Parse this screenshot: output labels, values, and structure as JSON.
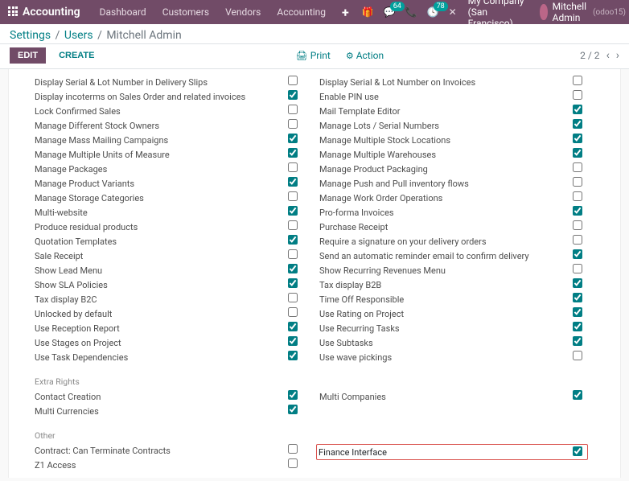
{
  "topbar": {
    "brand": "Accounting",
    "nav": [
      "Dashboard",
      "Customers",
      "Vendors",
      "Accounting"
    ],
    "msg_badge": "64",
    "call_badge": "78",
    "company": "My Company (San Francisco)",
    "user": "Mitchell Admin",
    "db": "(odoo15)"
  },
  "breadcrumb": {
    "a": "Settings",
    "b": "Users",
    "cur": "Mitchell Admin"
  },
  "toolbar": {
    "edit": "EDIT",
    "create": "CREATE",
    "print": "Print",
    "action": "Action",
    "pager": "2 / 2"
  },
  "perm_left": [
    {
      "label": "Display Serial & Lot Number in Delivery Slips",
      "checked": false
    },
    {
      "label": "Display incoterms on Sales Order and related invoices",
      "checked": true
    },
    {
      "label": "Lock Confirmed Sales",
      "checked": false
    },
    {
      "label": "Manage Different Stock Owners",
      "checked": false
    },
    {
      "label": "Manage Mass Mailing Campaigns",
      "checked": true
    },
    {
      "label": "Manage Multiple Units of Measure",
      "checked": true
    },
    {
      "label": "Manage Packages",
      "checked": false
    },
    {
      "label": "Manage Product Variants",
      "checked": true
    },
    {
      "label": "Manage Storage Categories",
      "checked": false
    },
    {
      "label": "Multi-website",
      "checked": true
    },
    {
      "label": "Produce residual products",
      "checked": false
    },
    {
      "label": "Quotation Templates",
      "checked": true
    },
    {
      "label": "Sale Receipt",
      "checked": false
    },
    {
      "label": "Show Lead Menu",
      "checked": true
    },
    {
      "label": "Show SLA Policies",
      "checked": true
    },
    {
      "label": "Tax display B2C",
      "checked": false
    },
    {
      "label": "Unlocked by default",
      "checked": false
    },
    {
      "label": "Use Reception Report",
      "checked": true
    },
    {
      "label": "Use Stages on Project",
      "checked": true
    },
    {
      "label": "Use Task Dependencies",
      "checked": true
    }
  ],
  "perm_right": [
    {
      "label": "Display Serial & Lot Number on Invoices",
      "checked": false
    },
    {
      "label": "Enable PIN use",
      "checked": false
    },
    {
      "label": "Mail Template Editor",
      "checked": true
    },
    {
      "label": "Manage Lots / Serial Numbers",
      "checked": true
    },
    {
      "label": "Manage Multiple Stock Locations",
      "checked": true
    },
    {
      "label": "Manage Multiple Warehouses",
      "checked": true
    },
    {
      "label": "Manage Product Packaging",
      "checked": false
    },
    {
      "label": "Manage Push and Pull inventory flows",
      "checked": false
    },
    {
      "label": "Manage Work Order Operations",
      "checked": false
    },
    {
      "label": "Pro-forma Invoices",
      "checked": true
    },
    {
      "label": "Purchase Receipt",
      "checked": false
    },
    {
      "label": "Require a signature on your delivery orders",
      "checked": false
    },
    {
      "label": "Send an automatic reminder email to confirm delivery",
      "checked": true
    },
    {
      "label": "Show Recurring Revenues Menu",
      "checked": false
    },
    {
      "label": "Tax display B2B",
      "checked": true
    },
    {
      "label": "Time Off Responsible",
      "checked": true
    },
    {
      "label": "Use Rating on Project",
      "checked": true
    },
    {
      "label": "Use Recurring Tasks",
      "checked": true
    },
    {
      "label": "Use Subtasks",
      "checked": true
    },
    {
      "label": "Use wave pickings",
      "checked": false
    }
  ],
  "sections": {
    "extra": "Extra Rights",
    "other": "Other"
  },
  "extra_left": [
    {
      "label": "Contact Creation",
      "checked": true
    },
    {
      "label": "Multi Currencies",
      "checked": true
    }
  ],
  "extra_right": [
    {
      "label": "Multi Companies",
      "checked": true
    }
  ],
  "other_left": [
    {
      "label": "Contract: Can Terminate Contracts",
      "checked": false
    },
    {
      "label": "Z1 Access",
      "checked": false
    }
  ],
  "other_right": [
    {
      "label": "Finance Interface",
      "checked": true,
      "highlight": true
    }
  ]
}
